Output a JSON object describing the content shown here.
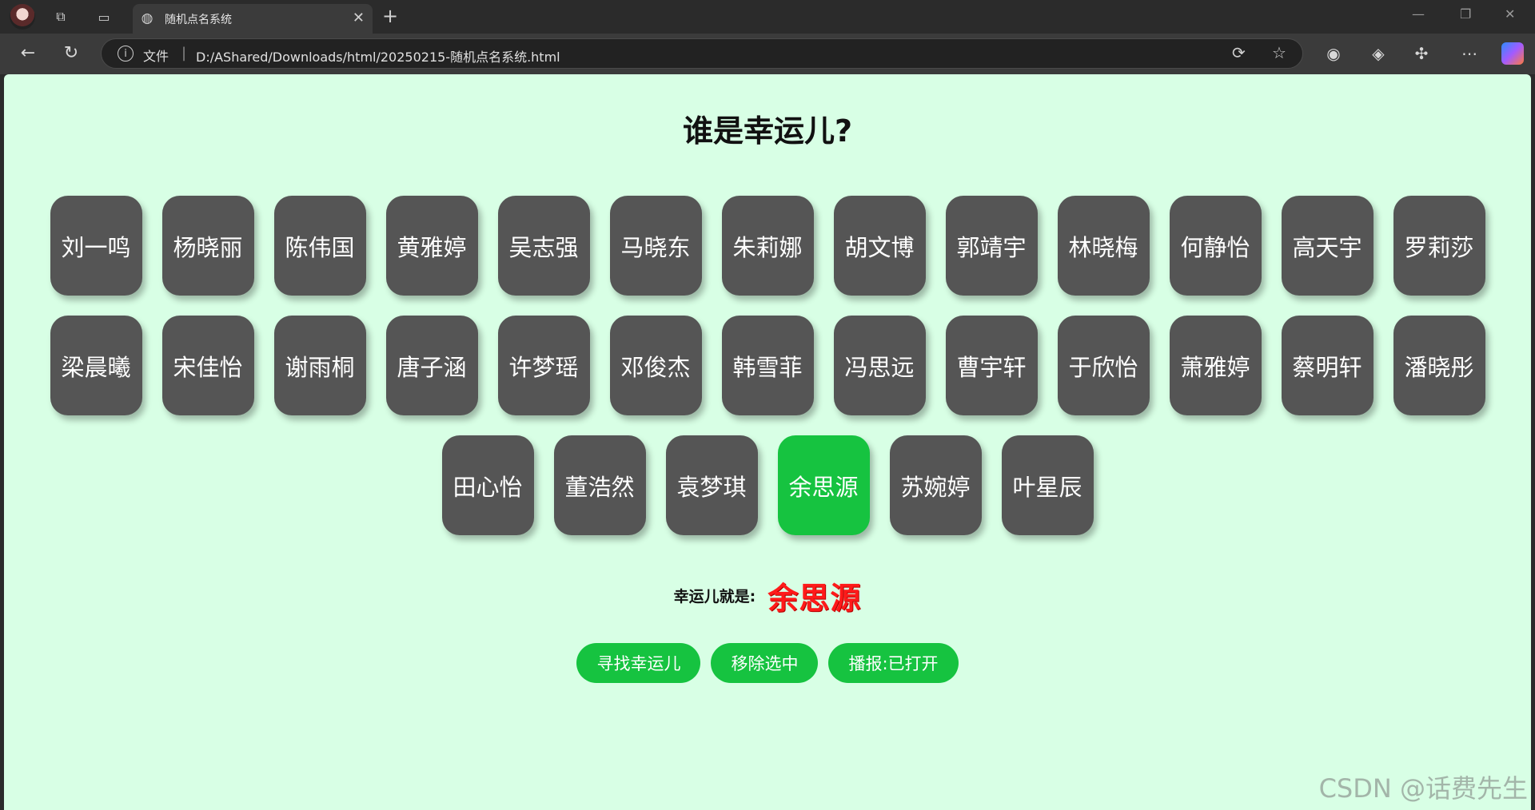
{
  "browser": {
    "tab_title": "随机点名系统",
    "address_label": "文件",
    "url": "D:/AShared/Downloads/html/20250215-随机点名系统.html"
  },
  "page": {
    "title": "谁是幸运儿?",
    "rows": [
      [
        "刘一鸣",
        "杨晓丽",
        "陈伟国",
        "黄雅婷",
        "吴志强",
        "马晓东",
        "朱莉娜",
        "胡文博",
        "郭靖宇",
        "林晓梅",
        "何静怡",
        "高天宇",
        "罗莉莎"
      ],
      [
        "梁晨曦",
        "宋佳怡",
        "谢雨桐",
        "唐子涵",
        "许梦瑶",
        "邓俊杰",
        "韩雪菲",
        "冯思远",
        "曹宇轩",
        "于欣怡",
        "萧雅婷",
        "蔡明轩",
        "潘晓彤"
      ],
      [
        "田心怡",
        "董浩然",
        "袁梦琪",
        "余思源",
        "苏婉婷",
        "叶星辰"
      ]
    ],
    "selected_name": "余思源",
    "result_label": "幸运儿就是:",
    "result_name": "余思源",
    "buttons": {
      "find": "寻找幸运儿",
      "remove": "移除选中",
      "broadcast": "播报:已打开"
    },
    "watermark": "CSDN @话费先生"
  },
  "colors": {
    "page_bg": "#d8ffe5",
    "card_bg": "#555555",
    "accent_green": "#16c340",
    "result_red": "#ff1a1a"
  }
}
